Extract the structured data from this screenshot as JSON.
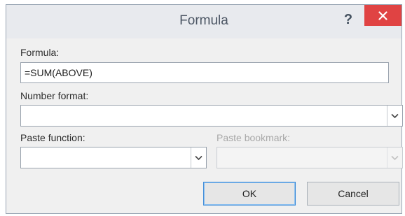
{
  "dialog": {
    "title": "Formula",
    "help_label": "?",
    "close_icon": "close-icon",
    "close_color": "#e04343"
  },
  "formula": {
    "label": "Formula:",
    "value": "=SUM(ABOVE)"
  },
  "number_format": {
    "label": "Number format:",
    "value": ""
  },
  "paste_function": {
    "label": "Paste function:",
    "value": ""
  },
  "paste_bookmark": {
    "label": "Paste bookmark:",
    "value": "",
    "enabled": false
  },
  "buttons": {
    "ok": "OK",
    "cancel": "Cancel"
  }
}
